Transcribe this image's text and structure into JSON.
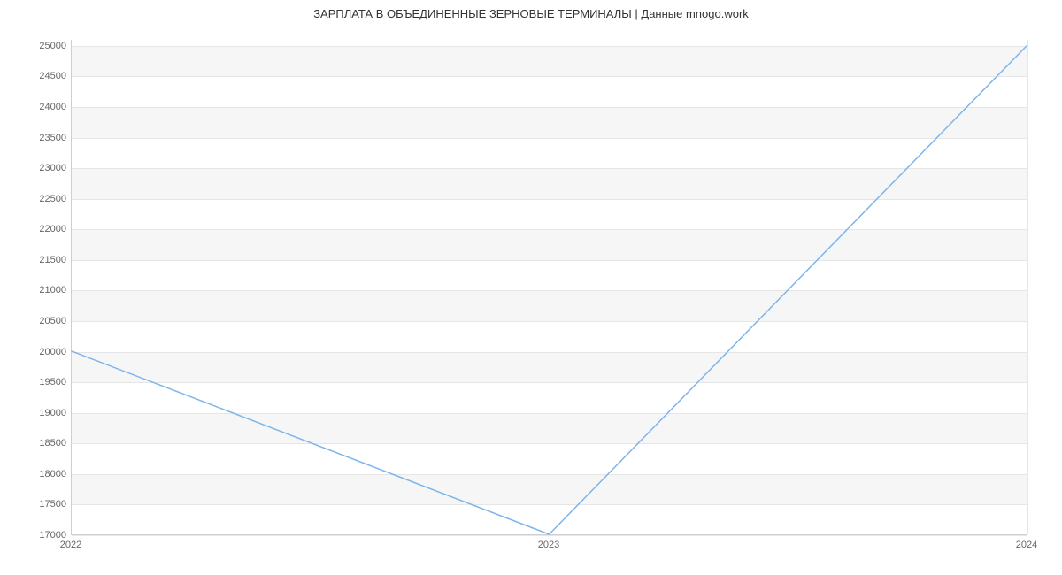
{
  "chart_data": {
    "type": "line",
    "title": "ЗАРПЛАТА В ОБЪЕДИНЕННЫЕ ЗЕРНОВЫЕ ТЕРМИНАЛЫ | Данные mnogo.work",
    "xlabel": "",
    "ylabel": "",
    "x": [
      2022,
      2023,
      2024
    ],
    "values": [
      20000,
      17000,
      25000
    ],
    "x_ticks": [
      2022,
      2023,
      2024
    ],
    "y_ticks": [
      17000,
      17500,
      18000,
      18500,
      19000,
      19500,
      20000,
      20500,
      21000,
      21500,
      22000,
      22500,
      23000,
      23500,
      24000,
      24500,
      25000
    ],
    "xlim": [
      2022,
      2024
    ],
    "ylim": [
      17000,
      25100
    ],
    "grid": true,
    "colors": {
      "line": "#7cb5ec",
      "band": "#f6f6f6",
      "grid": "#e6e6e6"
    }
  }
}
